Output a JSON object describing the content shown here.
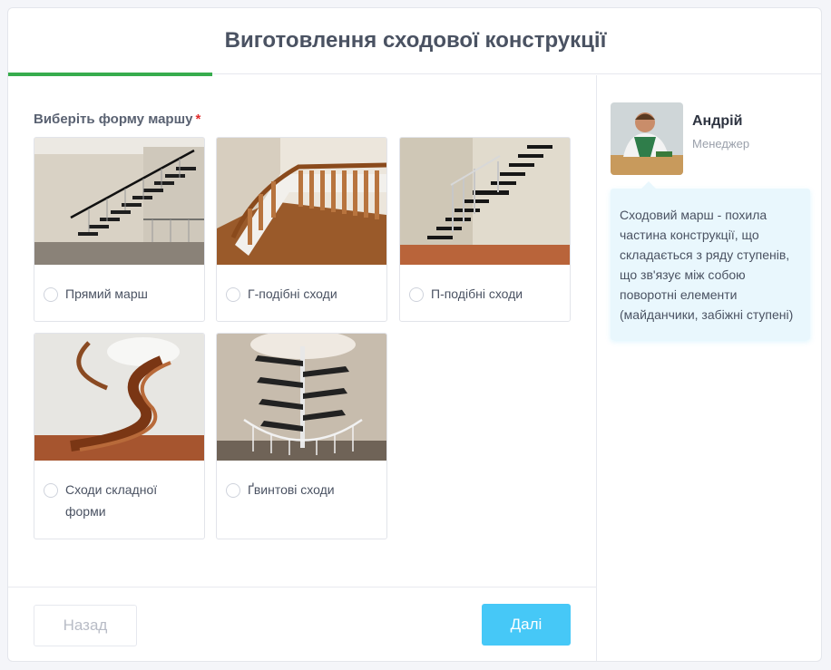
{
  "header": {
    "title": "Виготовлення сходової конструкції",
    "progress_percent": 25,
    "accent": "#37ac4d"
  },
  "question": {
    "label": "Виберіть форму маршу",
    "required_mark": "*"
  },
  "options": [
    {
      "label": "Прямий марш",
      "image": "straight-stair-photo"
    },
    {
      "label": "Г-подібні сходи",
      "image": "l-shaped-stair-photo"
    },
    {
      "label": "П-подібні сходи",
      "image": "u-shaped-stair-photo"
    },
    {
      "label": "Сходи складної форми",
      "image": "complex-stair-photo"
    },
    {
      "label": "Ґвинтові сходи",
      "image": "spiral-stair-photo"
    }
  ],
  "footer": {
    "back_label": "Назад",
    "next_label": "Далі",
    "next_color": "#46c8f7"
  },
  "manager": {
    "name": "Андрій",
    "role": "Менеджер",
    "tip": "Сходовий марш - похила частина конструкції, що складається з ряду ступенів, що зв'язує між собою поворотні елементи (майданчики, забіжні ступені)"
  }
}
